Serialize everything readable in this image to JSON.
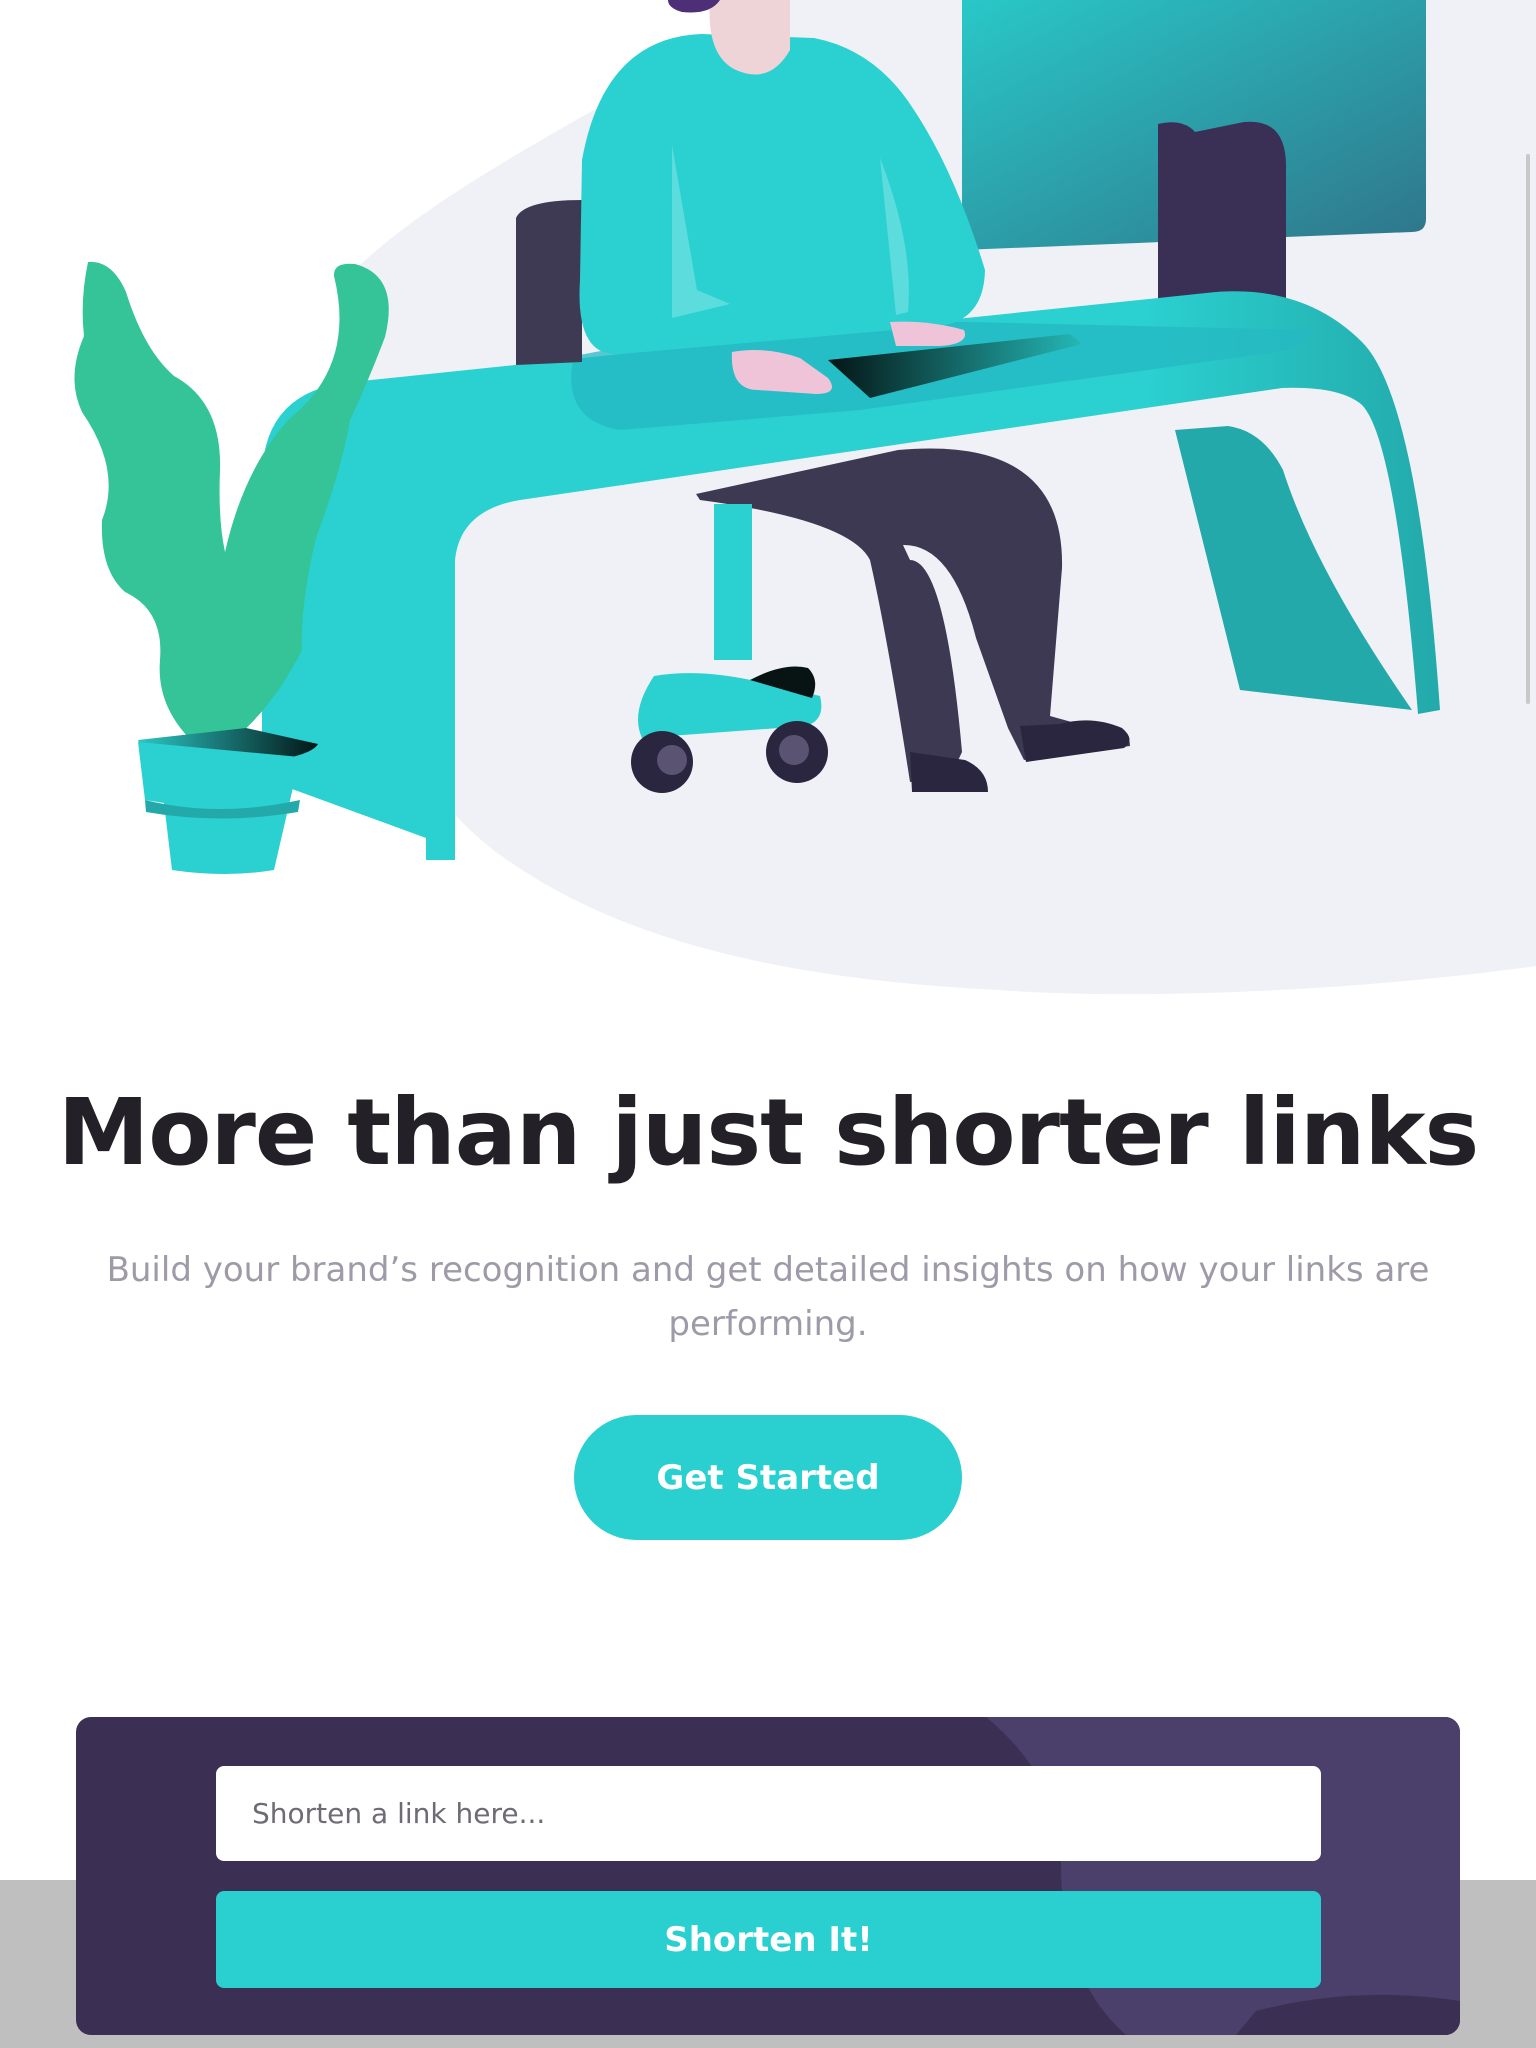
{
  "colors": {
    "cyan": "#2acfcf",
    "dark_violet": "#3b3054",
    "very_dark_text": "#232127",
    "grayish_text": "#9e9aa8",
    "pale_background": "#eff1f7"
  },
  "illustration": {
    "icon": "working-person-illustration-icon"
  },
  "hero": {
    "title": "More than just shorter links",
    "description": "Build your brand’s recognition and get detailed insights on how your links are performing.",
    "cta_label": "Get Started"
  },
  "shortener": {
    "placeholder": "Shorten a link here...",
    "value": "",
    "button_label": "Shorten It!"
  }
}
